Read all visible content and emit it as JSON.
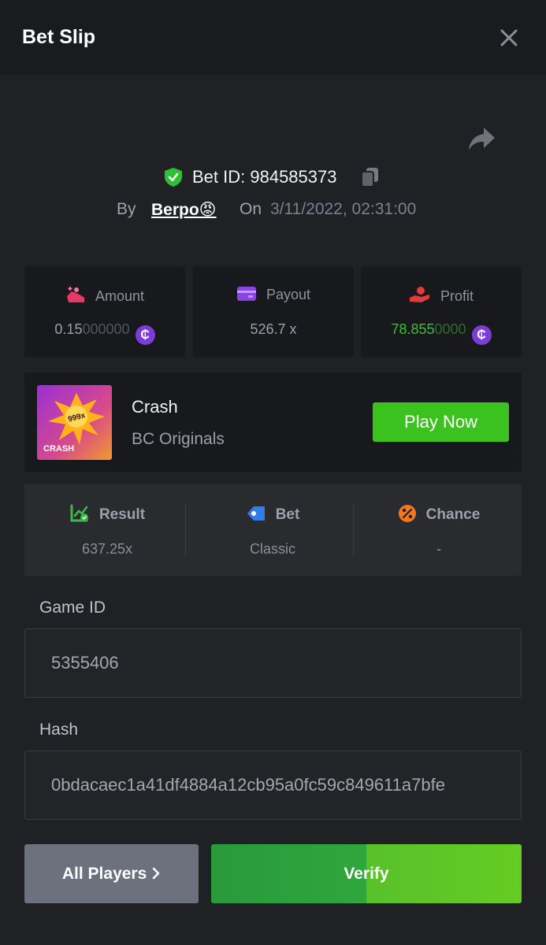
{
  "header": {
    "title": "Bet Slip"
  },
  "bet": {
    "id_label": "Bet ID: 984585373",
    "by_label": "By",
    "user": "Berpo😡",
    "on_label": "On",
    "datetime": "3/11/2022, 02:31:00"
  },
  "stats": {
    "amount": {
      "label": "Amount",
      "value_main": "0.15",
      "value_dim": "000000"
    },
    "payout": {
      "label": "Payout",
      "value": "526.7 x"
    },
    "profit": {
      "label": "Profit",
      "value_main": "78.855",
      "value_dim": "0000"
    },
    "coin_symbol": "₵"
  },
  "game": {
    "name": "Crash",
    "provider": "BC Originals",
    "play_label": "Play Now",
    "thumb_badge": "999x",
    "thumb_text": "CRASH"
  },
  "result": {
    "result_label": "Result",
    "result_value": "637.25x",
    "bet_label": "Bet",
    "bet_value": "Classic",
    "chance_label": "Chance",
    "chance_value": "-"
  },
  "fields": {
    "game_id_label": "Game ID",
    "game_id_value": "5355406",
    "hash_label": "Hash",
    "hash_value": "0bdacaec1a41df4884a12cb95a0fc59c849611a7bfe"
  },
  "actions": {
    "all_players": "All Players",
    "verify": "Verify"
  },
  "colors": {
    "accent_green": "#3cc21f",
    "coin_purple": "#7d3cd8",
    "profit_green": "#37c32e"
  }
}
